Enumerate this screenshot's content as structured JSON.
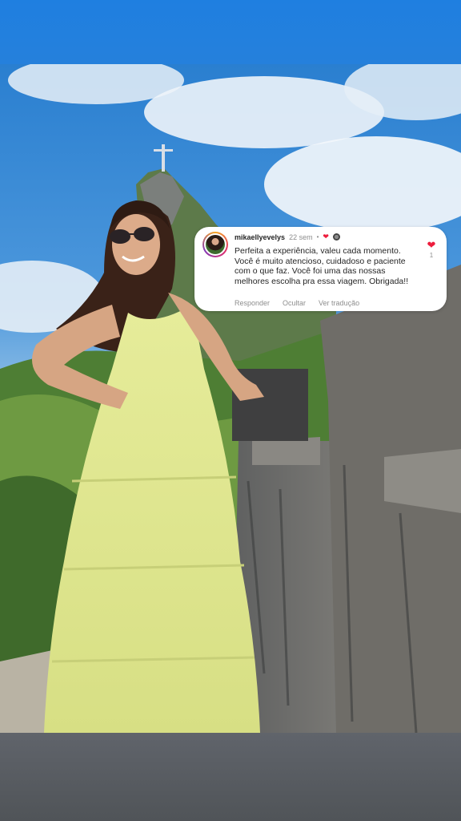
{
  "story": {
    "accent_top": "#1f7fe0",
    "accent_bottom": "#5b5f66"
  },
  "comment": {
    "username": "mikaellyevelys",
    "time": "22 sem",
    "separator": "•",
    "text": "Perfeita a experiência, valeu cada momento. Você é muito atencioso, cuidadoso e paciente com o que faz. Você foi uma das nossas melhores escolha pra essa viagem. Obrigada!!",
    "like_count": "1",
    "actions": {
      "reply": "Responder",
      "hide": "Ocultar",
      "translate": "Ver tradução"
    },
    "icons": {
      "author_liked": "heart-icon",
      "like": "heart-icon"
    },
    "heart_color": "#ed1c3c"
  }
}
